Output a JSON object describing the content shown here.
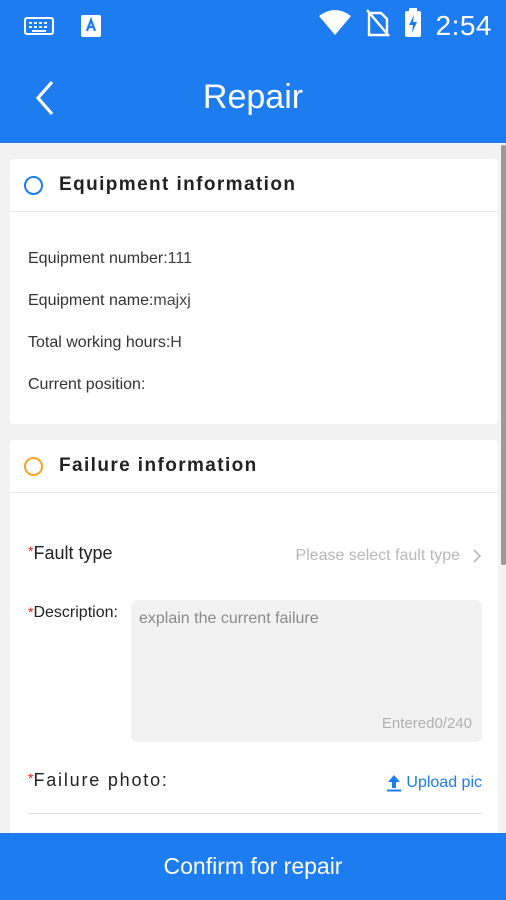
{
  "status": {
    "time": "2:54"
  },
  "header": {
    "title": "Repair"
  },
  "equipment": {
    "title": "Equipment information",
    "rows": [
      {
        "label": "Equipment number:",
        "value": "111"
      },
      {
        "label": "Equipment name:",
        "value": "majxj"
      },
      {
        "label": "Total working hours:",
        "value": "H"
      },
      {
        "label": "Current position:",
        "value": ""
      }
    ]
  },
  "failure": {
    "title": "Failure information",
    "required_mark": "*",
    "fault_type_label": "Fault type",
    "fault_type_placeholder": "Please select fault type",
    "description_label": "Description:",
    "description_placeholder": "explain the current failure",
    "description_value": "",
    "counter": "Entered0/240",
    "photo_label": "Failure photo:",
    "upload_label": "Upload pic"
  },
  "footer": {
    "confirm_label": "Confirm for repair"
  },
  "colors": {
    "primary": "#1c7cf0",
    "accent_orange": "#f5a623",
    "required": "#e02020"
  }
}
